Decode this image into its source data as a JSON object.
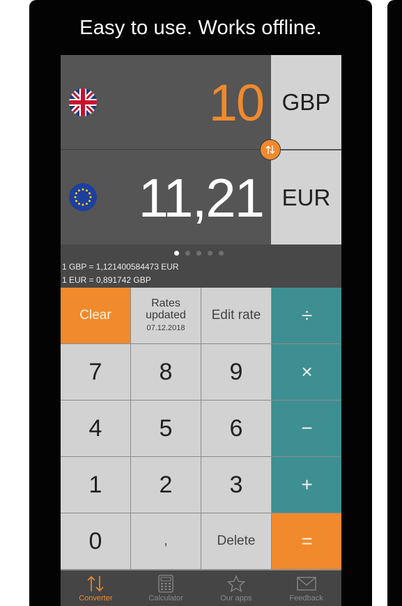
{
  "headline": "Easy to use. Works offline.",
  "converter": {
    "top": {
      "amount": "10",
      "currency": "GBP",
      "flag": "uk-flag-icon"
    },
    "bottom": {
      "amount": "11,21",
      "currency": "EUR",
      "flag": "eu-flag-icon"
    },
    "swap_icon": "swap-arrows-icon",
    "page_dots": {
      "count": 5,
      "active": 0
    },
    "rates": {
      "line1": "1 GBP = 1,121400584473 EUR",
      "line2": "1 EUR = 0,891742 GBP"
    }
  },
  "keypad": {
    "clear": "Clear",
    "rates_updated": "Rates updated",
    "rates_date": "07.12.2018",
    "edit_rate": "Edit rate",
    "divide": "÷",
    "multiply": "×",
    "minus": "−",
    "plus": "+",
    "equals": "=",
    "delete": "Delete",
    "decimal": ",",
    "digits": {
      "d0": "0",
      "d1": "1",
      "d2": "2",
      "d3": "3",
      "d4": "4",
      "d5": "5",
      "d6": "6",
      "d7": "7",
      "d8": "8",
      "d9": "9"
    }
  },
  "tabs": [
    {
      "label": "Converter",
      "icon": "swap-arrows-icon",
      "active": true
    },
    {
      "label": "Calculator",
      "icon": "calculator-icon",
      "active": false
    },
    {
      "label": "Our apps",
      "icon": "star-icon",
      "active": false
    },
    {
      "label": "Feedback",
      "icon": "envelope-icon",
      "active": false
    }
  ],
  "colors": {
    "accent_orange": "#f08a2c",
    "operator_teal": "#3e8f91",
    "key_gray": "#d2d2d2",
    "display_gray": "#555555"
  }
}
